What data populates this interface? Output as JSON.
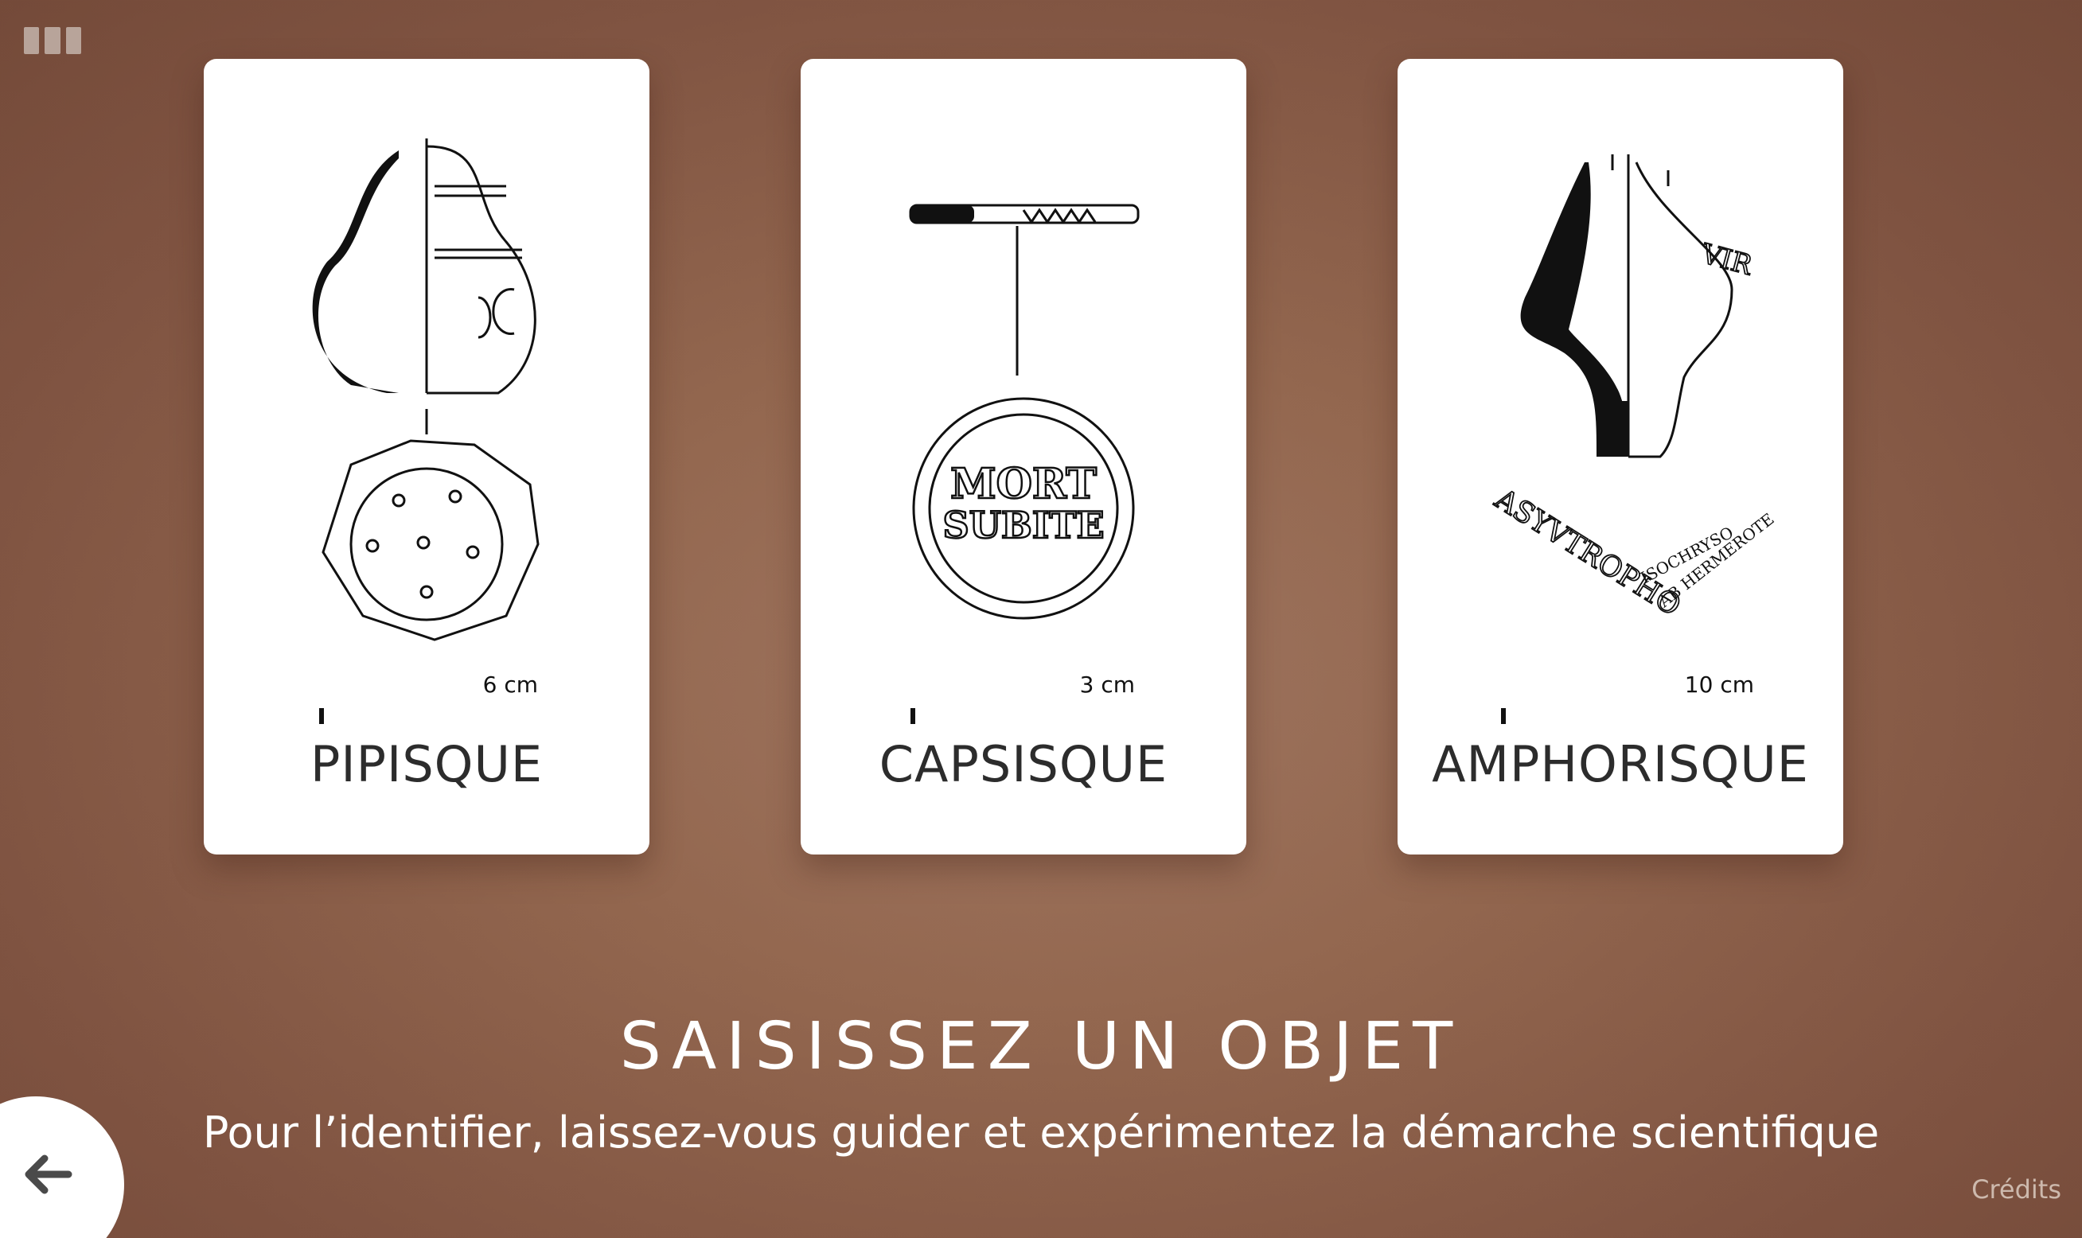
{
  "menu": {
    "icon": "menu-bars-icon"
  },
  "cards": [
    {
      "title": "PIPISQUE",
      "scale_label": "6 cm",
      "drawing": "pipisque-vessel-drawing"
    },
    {
      "title": "CAPSISQUE",
      "scale_label": "3 cm",
      "drawing": "capsisque-bottle-cap-drawing",
      "cap_text_line1": "MORT",
      "cap_text_line2": "SUBITE"
    },
    {
      "title": "AMPHORISQUE",
      "scale_label": "10 cm",
      "drawing": "amphorisque-vessel-drawing",
      "inscription_top": "VIR",
      "inscription_left": "ASYVTROPHO",
      "inscription_right_1": "ISOCHRYSO",
      "inscription_right_2": "AB HERMEROTE"
    }
  ],
  "main_title": "SAISISSEZ UN OBJET",
  "subtitle": "Pour l’identifier, laissez-vous guider et expérimentez la démarche scientifique",
  "back_button": {
    "icon": "arrow-left-icon"
  },
  "credits_label": "Crédits",
  "colors": {
    "background": "#93674f",
    "card": "#ffffff",
    "ink": "#111111",
    "title_text": "#2c2c2c"
  }
}
